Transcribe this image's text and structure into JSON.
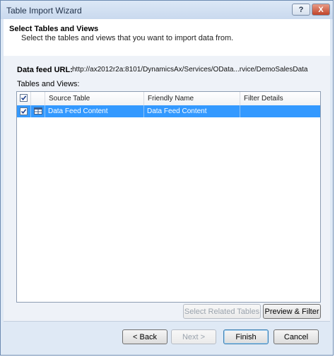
{
  "window": {
    "title": "Table Import Wizard"
  },
  "titlebar_buttons": {
    "help": "?",
    "close": "X"
  },
  "header": {
    "title": "Select Tables and Views",
    "subtitle": "Select the tables and views that you want to import data from."
  },
  "feed": {
    "label": "Data feed URL:",
    "url": "http://ax2012r2a:8101/DynamicsAx/Services/OData...rvice/DemoSalesData"
  },
  "tables_label": "Tables and Views:",
  "grid": {
    "columns": [
      "Source Table",
      "Friendly Name",
      "Filter Details"
    ],
    "rows": [
      {
        "checked": true,
        "source_table": "Data Feed Content",
        "friendly_name": "Data Feed Content",
        "filter_details": ""
      }
    ],
    "select_all_checked": true
  },
  "buttons": {
    "select_related": "Select Related Tables",
    "preview_filter": "Preview & Filter",
    "back": "< Back",
    "next": "Next >",
    "finish": "Finish",
    "cancel": "Cancel"
  },
  "colors": {
    "selection": "#3399ff",
    "window_frame": "#dfe9f5",
    "header_bg": "#ffffff"
  }
}
